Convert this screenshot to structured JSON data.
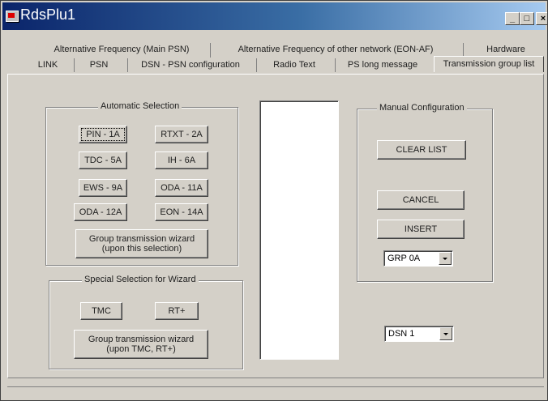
{
  "window": {
    "title": "RdsPlu1"
  },
  "tabs": {
    "row1": [
      {
        "label": "Alternative Frequency (Main PSN)"
      },
      {
        "label": "Alternative Frequency of other network (EON-AF)"
      },
      {
        "label": "Hardware"
      }
    ],
    "row2": [
      {
        "label": "LINK"
      },
      {
        "label": "PSN"
      },
      {
        "label": "DSN - PSN configuration"
      },
      {
        "label": "Radio Text"
      },
      {
        "label": "PS long message"
      },
      {
        "label": "Transmission group list"
      }
    ],
    "active": "Transmission group list"
  },
  "automatic": {
    "title": "Automatic Selection",
    "buttons": [
      "PIN - 1A",
      "RTXT - 2A",
      "TDC - 5A",
      "IH - 6A",
      "EWS - 9A",
      "ODA - 11A",
      "ODA - 12A",
      "EON - 14A"
    ],
    "wizard_line1": "Group transmission wizard",
    "wizard_line2": "(upon this selection)"
  },
  "special": {
    "title": "Special Selection for Wizard",
    "tmc": "TMC",
    "rt_plus": "RT+",
    "wizard_line1": "Group transmission wizard",
    "wizard_line2": "(upon TMC, RT+)"
  },
  "manual": {
    "title": "Manual Configuration",
    "clear": "CLEAR LIST",
    "cancel": "CANCEL",
    "insert": "INSERT",
    "group_select": "GRP 0A"
  },
  "dsn_select": "DSN 1"
}
